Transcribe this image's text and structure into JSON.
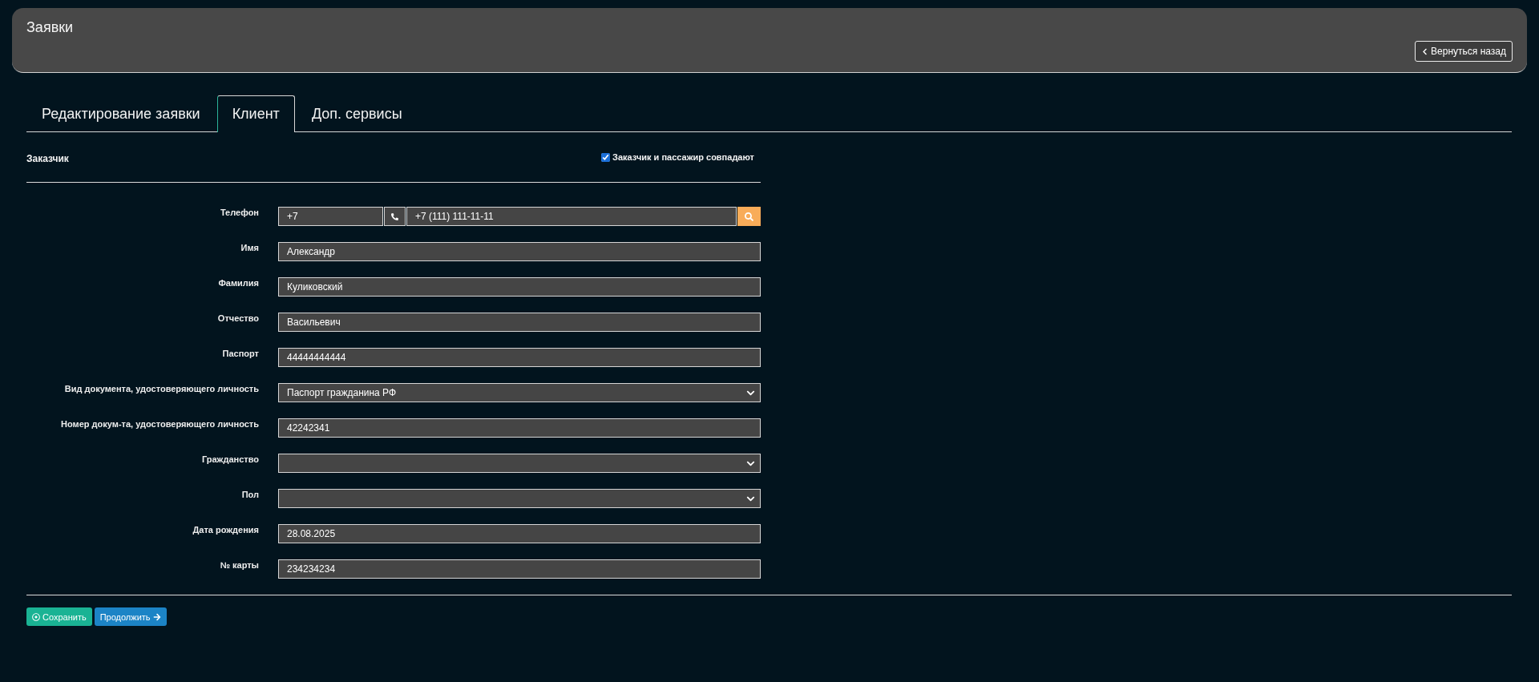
{
  "header": {
    "title": "Заявки",
    "back_button": "Вернуться назад"
  },
  "tabs": [
    {
      "label": "Редактирование заявки",
      "selected": false
    },
    {
      "label": "Клиент",
      "selected": true
    },
    {
      "label": "Доп. сервисы",
      "selected": false
    }
  ],
  "section": {
    "title": "Заказчик",
    "same_passenger": {
      "label": "Заказчик и пассажир совпадают",
      "checked": true
    }
  },
  "phone": {
    "label": "Телефон",
    "country_code": "+7",
    "value": "+7 (111) 111-11-11"
  },
  "fields": [
    {
      "label": "Имя",
      "kind": "text",
      "value": "Александр"
    },
    {
      "label": "Фамилия",
      "kind": "text",
      "value": "Куликовский"
    },
    {
      "label": "Отчество",
      "kind": "text",
      "value": "Васильевич"
    },
    {
      "label": "Паспорт",
      "kind": "text",
      "value": "44444444444"
    },
    {
      "label": "Вид документа, удостоверяющего личность",
      "kind": "select",
      "value": "Паспорт гражданина РФ"
    },
    {
      "label": "Номер докум-та, удостоверяющего личность",
      "kind": "text",
      "value": "42242341"
    },
    {
      "label": "Гражданство",
      "kind": "select"
    },
    {
      "label": "Пол",
      "kind": "select"
    },
    {
      "label": "Дата рождения",
      "kind": "text",
      "value": "28.08.2025"
    },
    {
      "label": "№ карты",
      "kind": "text",
      "value": "234234234"
    }
  ],
  "buttons": [
    {
      "label": "Сохранить",
      "kind": "save"
    },
    {
      "label": "Продолжить",
      "kind": "continue"
    }
  ]
}
